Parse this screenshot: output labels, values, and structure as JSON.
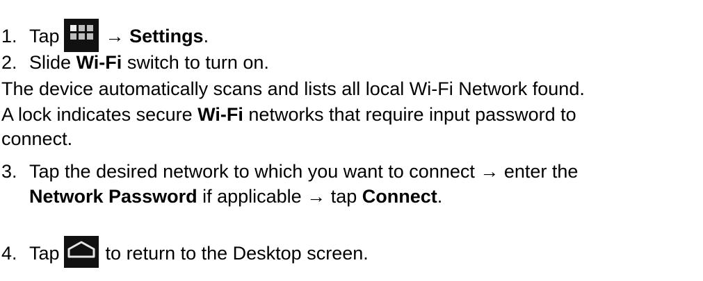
{
  "steps": {
    "s1": {
      "num": "1.",
      "pre": "Tap",
      "arrow": "→",
      "bold": "Settings",
      "post": ".",
      "icon": "apps-grid-icon"
    },
    "s2": {
      "num": "2.",
      "pre": "Slide",
      "bold": "Wi-Fi",
      "post": "switch to turn on."
    },
    "s3": {
      "num": "3.",
      "pre": "Tap the desired network to which you want to connect → enter the",
      "bold1": "Network Password",
      "mid": "if applicable → tap",
      "bold2": "Connect",
      "post": "."
    },
    "s4": {
      "num": "4.",
      "pre": "Tap",
      "post": "to return to the Desktop screen.",
      "icon": "home-icon"
    }
  },
  "paragraph": {
    "line1": "The device automatically scans and lists all local Wi-Fi Network found.",
    "line2_pre": "A lock indicates secure",
    "line2_bold": "Wi-Fi",
    "line2_post": "networks that require input password to",
    "line3": "connect."
  },
  "colors": {
    "text": "#000000",
    "icon_bg": "#111111",
    "icon_fg": "#bdbdbd"
  }
}
